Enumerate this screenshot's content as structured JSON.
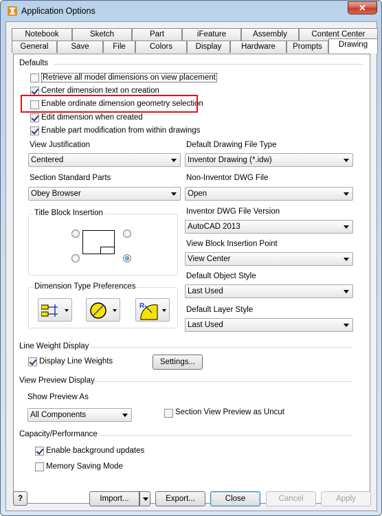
{
  "window": {
    "title": "Application Options",
    "close_label": "✕"
  },
  "tabs": {
    "row1": [
      "Notebook",
      "Sketch",
      "Part",
      "iFeature",
      "Assembly",
      "Content Center"
    ],
    "row2": [
      "General",
      "Save",
      "File",
      "Colors",
      "Display",
      "Hardware",
      "Prompts",
      "Drawing"
    ]
  },
  "defaults": {
    "heading": "Defaults",
    "checkboxes": [
      {
        "label": "Retrieve all model dimensions on view placement",
        "checked": false
      },
      {
        "label": "Center dimension text on creation",
        "checked": true
      },
      {
        "label": "Enable ordinate dimension geometry selection",
        "checked": false
      },
      {
        "label": "Edit dimension when created",
        "checked": true
      },
      {
        "label": "Enable part modification from within drawings",
        "checked": true
      }
    ]
  },
  "left": {
    "view_justification": {
      "label": "View Justification",
      "value": "Centered"
    },
    "section_standard_parts": {
      "label": "Section Standard Parts",
      "value": "Obey Browser"
    },
    "title_block": {
      "label": "Title Block Insertion",
      "selected": "bottom-right"
    },
    "dimension_type": {
      "label": "Dimension Type Preferences",
      "icons": [
        "linear-dimension-icon",
        "diameter-dimension-icon",
        "radius-dimension-icon"
      ]
    }
  },
  "right": {
    "drawing_file_type": {
      "label": "Default Drawing File Type",
      "value": "Inventor Drawing (*.idw)"
    },
    "non_inventor_dwg": {
      "label": "Non-Inventor DWG File",
      "value": "Open"
    },
    "dwg_version": {
      "label": "Inventor DWG File Version",
      "value": "AutoCAD 2013"
    },
    "view_block_insertion": {
      "label": "View Block Insertion Point",
      "value": "View Center"
    },
    "object_style": {
      "label": "Default Object Style",
      "value": "Last Used"
    },
    "layer_style": {
      "label": "Default Layer Style",
      "value": "Last Used"
    }
  },
  "line_weight": {
    "heading": "Line Weight Display",
    "checkbox": "Display Line Weights",
    "checked": true,
    "settings_button": "Settings..."
  },
  "view_preview": {
    "heading": "View Preview Display",
    "show_label": "Show Preview As",
    "show_value": "All Components",
    "section_checkbox": "Section View Preview as Uncut",
    "section_checked": false
  },
  "capacity": {
    "heading": "Capacity/Performance",
    "background_updates": "Enable background updates",
    "background_checked": true,
    "memory_saving": "Memory Saving Mode",
    "memory_checked": false
  },
  "footer": {
    "help_label": "?",
    "import": "Import...",
    "export": "Export...",
    "close": "Close",
    "cancel": "Cancel",
    "apply": "Apply"
  }
}
